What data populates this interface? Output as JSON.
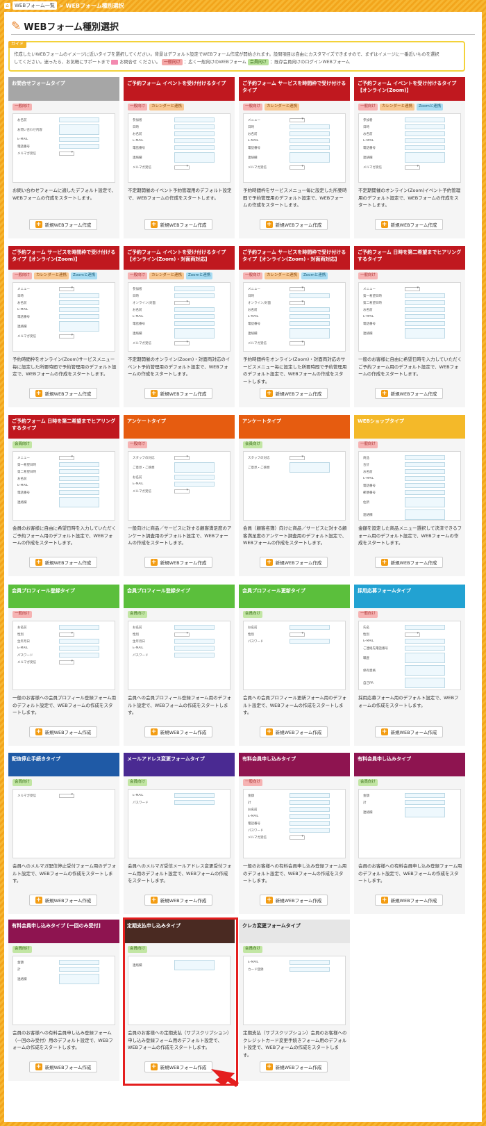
{
  "breadcrumb": {
    "home_icon": "home-icon",
    "link": "WEBフォーム一覧",
    "separator": ">",
    "current": "WEBフォーム種別選択"
  },
  "page": {
    "title": "WEBフォーム種別選択",
    "title_icon": "pencil-icon"
  },
  "guide": {
    "label": "ガイド",
    "line1": "作成したいWEBフォームのイメージに近いタイプを選択してください。背景はデフォルト設定でWEBフォーム作成が開始されます。設問項目は自由にカスタマイズできますので、まずはイメージに一番近いものを選択",
    "line2_a": "してください。迷ったら、お気軽にサポートまで",
    "line2_mail": "お問合せ",
    "line2_b": "ください。",
    "badge_general": "一般向け",
    "text_general": "：広く一般向けのWEBフォーム",
    "badge_member": "会員向け",
    "text_member": "：既存会員向けのログインWEBフォーム"
  },
  "button_label": "新規WEBフォーム作成",
  "cards": [
    {
      "title": "お問合せフォームタイプ",
      "color": "#a6a6a6",
      "badges": [
        "一般向け"
      ],
      "desc": "お問い合わせフォームに適したデフォルト設定で、WEBフォームの作成をスタートします。",
      "fields": [
        [
          "お名前",
          "i"
        ],
        [
          "お問い合わせ内容",
          "t"
        ],
        [
          "E-MAIL",
          "i"
        ],
        [
          "電話番号",
          "i"
        ],
        [
          "メルマガ受信",
          "s"
        ]
      ]
    },
    {
      "title": "ご予約フォーム イベントを受け付けるタイプ",
      "color": "#c0181f",
      "badges": [
        "一般向け",
        "カレンダーと連携"
      ],
      "desc": "不定期開催のイベント予約管理用のデフォルト設定で、WEBフォームの作成をスタートします。",
      "fields": [
        [
          "参加者",
          "i"
        ],
        [
          "日時",
          "i"
        ],
        [
          "お名前",
          "i"
        ],
        [
          "E-MAIL",
          "i"
        ],
        [
          "電話番号",
          "i"
        ],
        [
          "連絡欄",
          "t"
        ],
        [
          "メルマガ受信",
          "s"
        ]
      ]
    },
    {
      "title": "ご予約フォーム サービスを時間枠で受け付けるタイプ",
      "color": "#c0181f",
      "badges": [
        "一般向け",
        "カレンダーと連携"
      ],
      "desc": "予約時間枠をサービスメニュー毎に設定した所要時間で予約管理用のデフォルト設定で、WEBフォームの作成をスタートします。",
      "fields": [
        [
          "メニュー",
          "s"
        ],
        [
          "日時",
          "i"
        ],
        [
          "お名前",
          "i"
        ],
        [
          "E-MAIL",
          "i"
        ],
        [
          "電話番号",
          "i"
        ],
        [
          "連絡欄",
          "t"
        ],
        [
          "メルマガ受信",
          "s"
        ]
      ]
    },
    {
      "title": "ご予約フォーム イベントを受け付けるタイプ【オンライン(Zoom)】",
      "color": "#c0181f",
      "badges": [
        "一般向け",
        "カレンダーと連携",
        "Zoomと連携"
      ],
      "desc": "不定期開催のオンライン(Zoom)イベント予約管理用のデフォルト設定で、WEBフォームの作成をスタートします。",
      "fields": [
        [
          "参加者",
          "i"
        ],
        [
          "日時",
          "i"
        ],
        [
          "お名前",
          "i"
        ],
        [
          "E-MAIL",
          "i"
        ],
        [
          "電話番号",
          "i"
        ],
        [
          "連絡欄",
          "t"
        ],
        [
          "メルマガ受信",
          "s"
        ]
      ]
    },
    {
      "title": "ご予約フォーム サービスを時間枠で受け付けるタイプ【オンライン(Zoom)】",
      "color": "#c0181f",
      "badges": [
        "一般向け",
        "カレンダーと連携",
        "Zoomと連携"
      ],
      "desc": "予約時間枠をオンライン(Zoom)サービスメニュー毎に設定した所要時間で予約管理用のデフォルト設定で、WEBフォームの作成をスタートします。",
      "fields": [
        [
          "メニュー",
          "s"
        ],
        [
          "日時",
          "i"
        ],
        [
          "お名前",
          "i"
        ],
        [
          "E-MAIL",
          "i"
        ],
        [
          "電話番号",
          "i"
        ],
        [
          "連絡欄",
          "t"
        ],
        [
          "メルマガ受信",
          "s"
        ]
      ]
    },
    {
      "title": "ご予約フォーム イベントを受け付けるタイプ【オンライン(Zoom)・対面両対応】",
      "color": "#c0181f",
      "badges": [
        "一般向け",
        "カレンダーと連携",
        "Zoomと連携"
      ],
      "desc": "不定期開催のオンライン(Zoom)・対面両対応のイベント予約管理用のデフォルト設定で、WEBフォームの作成をスタートします。",
      "fields": [
        [
          "参加者",
          "i"
        ],
        [
          "日時",
          "i"
        ],
        [
          "オンライン/対面",
          "s"
        ],
        [
          "お名前",
          "i"
        ],
        [
          "E-MAIL",
          "i"
        ],
        [
          "電話番号",
          "i"
        ],
        [
          "連絡欄",
          "t"
        ],
        [
          "メルマガ受信",
          "s"
        ]
      ]
    },
    {
      "title": "ご予約フォーム サービスを時間枠で受け付けるタイプ【オンライン(Zoom)・対面両対応】",
      "color": "#c0181f",
      "badges": [
        "一般向け",
        "カレンダーと連携",
        "Zoomと連携"
      ],
      "desc": "予約時間枠をオンライン(Zoom)・対面両対応のサービスメニュー毎に設定した所要時間で予約管理用のデフォルト設定で、WEBフォームの作成をスタートします。",
      "fields": [
        [
          "メニュー",
          "s"
        ],
        [
          "日時",
          "i"
        ],
        [
          "オンライン/対面",
          "s"
        ],
        [
          "お名前",
          "i"
        ],
        [
          "E-MAIL",
          "i"
        ],
        [
          "電話番号",
          "i"
        ],
        [
          "連絡欄",
          "t"
        ],
        [
          "メルマガ受信",
          "s"
        ]
      ]
    },
    {
      "title": "ご予約フォーム 日時を第二希望までヒアリングするタイプ",
      "color": "#c0181f",
      "badges": [
        "一般向け"
      ],
      "desc": "一般のお客様に自由に希望日時を入力していただくご予約フォーム用のデフォルト設定で、WEBフォームの作成をスタートします。",
      "fields": [
        [
          "メニュー",
          "s"
        ],
        [
          "第一希望日時",
          "i"
        ],
        [
          "第二希望日時",
          "i"
        ],
        [
          "お名前",
          "i"
        ],
        [
          "E-MAIL",
          "i"
        ],
        [
          "電話番号",
          "i"
        ],
        [
          "連絡欄",
          "t"
        ]
      ]
    },
    {
      "title": "ご予約フォーム 日時を第二希望までヒアリングするタイプ",
      "color": "#c0181f",
      "badges": [
        "会員向け"
      ],
      "desc": "会員のお客様に自由に希望日時を入力していただくご予約フォーム用のデフォルト設定で、WEBフォームの作成をスタートします。",
      "fields": [
        [
          "メニュー",
          "s"
        ],
        [
          "第一希望日時",
          "i"
        ],
        [
          "第二希望日時",
          "i"
        ],
        [
          "お名前",
          "i"
        ],
        [
          "E-MAIL",
          "i"
        ],
        [
          "電話番号",
          "i"
        ],
        [
          "連絡欄",
          "t"
        ]
      ]
    },
    {
      "title": "アンケートタイプ",
      "color": "#e65c10",
      "badges": [
        "一般向け"
      ],
      "desc": "一般向けに商品／サービスに対する顧客満足度のアンケート調査用のデフォルト設定で、WEBフォームの作成をスタートします。",
      "fields": [
        [
          "スタッフの対応",
          "s"
        ],
        [
          "ご意見・ご感想",
          "t"
        ],
        [
          "お名前",
          "i"
        ],
        [
          "E-MAIL",
          "i"
        ],
        [
          "メルマガ受信",
          "s"
        ]
      ]
    },
    {
      "title": "アンケートタイプ",
      "color": "#e65c10",
      "badges": [
        "会員向け"
      ],
      "desc": "会員（顧客名簿）向けに商品／サービスに対する顧客満足度のアンケート調査用のデフォルト設定で、WEBフォームの作成をスタートします。",
      "fields": [
        [
          "スタッフの対応",
          "s"
        ],
        [
          "ご意見・ご感想",
          "t"
        ]
      ]
    },
    {
      "title": "WEBショップタイプ",
      "color": "#f4b929",
      "badges": [
        "一般向け"
      ],
      "desc": "金額を設定した商品メニュー選択して決済できるフォーム用のデフォルト設定で、WEBフォームの作成をスタートします。",
      "fields": [
        [
          "商品",
          "i"
        ],
        [
          "合計",
          "i"
        ],
        [
          "お名前",
          "i"
        ],
        [
          "E-MAIL",
          "i"
        ],
        [
          "電話番号",
          "i"
        ],
        [
          "郵便番号",
          "i"
        ],
        [
          "住所",
          "t"
        ],
        [
          "連絡欄",
          "t"
        ]
      ]
    },
    {
      "title": "会員プロフィール登録タイプ",
      "color": "#5bbf3c",
      "badges": [
        "一般向け"
      ],
      "desc": "一般のお客様への会員プロフィール登録フォーム用のデフォルト設定で、WEBフォームの作成をスタートします。",
      "fields": [
        [
          "お名前",
          "i"
        ],
        [
          "性別",
          "s"
        ],
        [
          "生年月日",
          "i"
        ],
        [
          "E-MAIL",
          "i"
        ],
        [
          "パスワード",
          "i"
        ],
        [
          "メルマガ受信",
          "s"
        ]
      ]
    },
    {
      "title": "会員プロフィール登録タイプ",
      "color": "#5bbf3c",
      "badges": [
        "会員向け"
      ],
      "desc": "会員への会員プロフィール登録フォーム用のデフォルト設定で、WEBフォームの作成をスタートします。",
      "fields": [
        [
          "お名前",
          "i"
        ],
        [
          "性別",
          "s"
        ],
        [
          "生年月日",
          "i"
        ],
        [
          "E-MAIL",
          "i"
        ],
        [
          "パスワード",
          "i"
        ]
      ]
    },
    {
      "title": "会員プロフィール更新タイプ",
      "color": "#5bbf3c",
      "badges": [
        "会員向け"
      ],
      "desc": "会員への会員プロフィール更新フォーム用のデフォルト設定で、WEBフォームの作成をスタートします。",
      "fields": [
        [
          "お名前",
          "i"
        ],
        [
          "性別",
          "s"
        ],
        [
          "パスワード",
          "i"
        ]
      ]
    },
    {
      "title": "採用応募フォームタイプ",
      "color": "#22a2d2",
      "badges": [
        "一般向け"
      ],
      "desc": "採用応募フォーム用のデフォルト設定で、WEBフォームの作成をスタートします。",
      "fields": [
        [
          "氏名",
          "i"
        ],
        [
          "性別",
          "s"
        ],
        [
          "E-MAIL",
          "i"
        ],
        [
          "ご連絡先電話番号",
          "i"
        ],
        [
          "職歴",
          "t"
        ],
        [
          "保有資格",
          "t"
        ],
        [
          "自己PR",
          "t"
        ]
      ]
    },
    {
      "title": "配信停止手続きタイプ",
      "color": "#1f5aa6",
      "badges": [
        "会員向け"
      ],
      "desc": "会員へのメルマガ配信停止受付フォーム用のデフォルト設定で、WEBフォームの作成をスタートします。",
      "fields": [
        [
          "メルマガ受信",
          "s"
        ]
      ]
    },
    {
      "title": "メールアドレス変更フォームタイプ",
      "color": "#4a2a92",
      "badges": [
        "会員向け"
      ],
      "desc": "会員へのメルマガ受信メールアドレス変更受付フォーム用のデフォルト設定で、WEBフォームの作成をスタートします。",
      "fields": [
        [
          "E-MAIL",
          "i"
        ],
        [
          "パスワード",
          "i"
        ]
      ]
    },
    {
      "title": "有料会員申し込みタイプ",
      "color": "#8e1450",
      "badges": [
        "一般向け"
      ],
      "desc": "一般のお客様への有料会員申し込み登録フォーム用のデフォルト設定で、WEBフォームの作成をスタートします。",
      "fields": [
        [
          "金額",
          "i"
        ],
        [
          "計",
          "i"
        ],
        [
          "お名前",
          "i"
        ],
        [
          "E-MAIL",
          "i"
        ],
        [
          "電話番号",
          "i"
        ],
        [
          "パスワード",
          "i"
        ],
        [
          "メルマガ受信",
          "s"
        ]
      ]
    },
    {
      "title": "有料会員申し込みタイプ",
      "color": "#8e1450",
      "badges": [
        "会員向け"
      ],
      "desc": "会員のお客様への有料会員申し込み登録フォーム用のデフォルト設定で、WEBフォームの作成をスタートします。",
      "fields": [
        [
          "金額",
          "i"
        ],
        [
          "計",
          "i"
        ],
        [
          "連絡欄",
          "t"
        ]
      ]
    },
    {
      "title": "有料会員申し込みタイプ [一回のみ受付]",
      "color": "#8e1450",
      "badges": [
        "会員向け"
      ],
      "desc": "会員のお客様への有料会員申し込み登録フォーム（一回のみ受付）用のデフォルト設定で、WEBフォームの作成をスタートします。",
      "fields": [
        [
          "金額",
          "i"
        ],
        [
          "計",
          "i"
        ],
        [
          "連絡欄",
          "t"
        ]
      ]
    },
    {
      "title": "定期支払申し込みタイプ",
      "color": "#4a2a22",
      "badges": [
        "会員向け"
      ],
      "desc": "会員のお客様への定期支払（サブスクリプション）申し込み登録フォーム用のデフォルト設定で、WEBフォームの作成をスタートします。",
      "fields": [
        [
          "連絡欄",
          "t"
        ]
      ]
    },
    {
      "title": "クレカ変更フォームタイプ",
      "color": "#e6e6e6",
      "title_color": "#222",
      "badges": [
        "会員向け"
      ],
      "desc": "定期支払（サブスクリプション）会員のお客様へのクレジットカード変更手続きフォーム用のデフォルト設定で、WEBフォームの作成をスタートします。",
      "fields": [
        [
          "E-MAIL",
          "i"
        ],
        [
          "カード登録",
          "i"
        ]
      ]
    }
  ]
}
